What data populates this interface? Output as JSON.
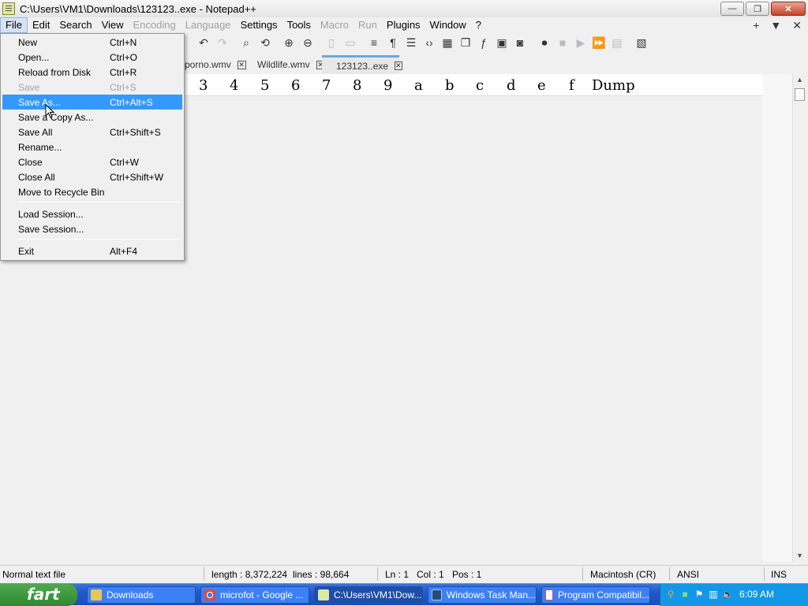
{
  "window": {
    "title": "C:\\Users\\VM1\\Downloads\\123123..exe - Notepad++",
    "controls": {
      "minimize": "—",
      "restore": "❐",
      "close": "✕"
    }
  },
  "menubar": {
    "items": [
      {
        "label": "File",
        "state": "open"
      },
      {
        "label": "Edit"
      },
      {
        "label": "Search"
      },
      {
        "label": "View"
      },
      {
        "label": "Encoding",
        "state": "disabled"
      },
      {
        "label": "Language",
        "state": "disabled"
      },
      {
        "label": "Settings"
      },
      {
        "label": "Tools"
      },
      {
        "label": "Macro",
        "state": "disabled"
      },
      {
        "label": "Run",
        "state": "disabled"
      },
      {
        "label": "Plugins"
      },
      {
        "label": "Window"
      },
      {
        "label": "?"
      }
    ],
    "right": {
      "add": "+",
      "dropdown": "▼",
      "close": "✕"
    }
  },
  "tabs": [
    {
      "label": "porno.wmv",
      "active": false
    },
    {
      "label": "Wildlife.wmv",
      "active": false
    },
    {
      "label": "123123..exe",
      "active": true
    }
  ],
  "hex_header": {
    "columns": [
      "3",
      "4",
      "5",
      "6",
      "7",
      "8",
      "9",
      "a",
      "b",
      "c",
      "d",
      "e",
      "f",
      "Dump"
    ]
  },
  "file_menu": {
    "items": [
      {
        "label": "New",
        "shortcut": "Ctrl+N"
      },
      {
        "label": "Open...",
        "shortcut": "Ctrl+O"
      },
      {
        "label": "Reload from Disk",
        "shortcut": "Ctrl+R"
      },
      {
        "label": "Save",
        "shortcut": "Ctrl+S",
        "disabled": true
      },
      {
        "label": "Save As...",
        "shortcut": "Ctrl+Alt+S",
        "highlighted": true
      },
      {
        "label": "Save a Copy As...",
        "shortcut": ""
      },
      {
        "label": "Save All",
        "shortcut": "Ctrl+Shift+S"
      },
      {
        "label": "Rename...",
        "shortcut": ""
      },
      {
        "label": "Close",
        "shortcut": "Ctrl+W"
      },
      {
        "label": "Close All",
        "shortcut": "Ctrl+Shift+W"
      },
      {
        "label": "Move to Recycle Bin",
        "shortcut": ""
      },
      {
        "label": "Load Session...",
        "shortcut": ""
      },
      {
        "label": "Save Session...",
        "shortcut": ""
      },
      {
        "label": "Exit",
        "shortcut": "Alt+F4"
      }
    ]
  },
  "statusbar": {
    "file_type": "Normal text file",
    "length": "length : 8,372,224",
    "lines": "lines : 98,664",
    "ln": "Ln : 1",
    "col": "Col : 1",
    "pos": "Pos : 1",
    "eol": "Macintosh (CR)",
    "encoding": "ANSI",
    "mode": "INS"
  },
  "taskbar": {
    "start_label": "fart",
    "tasks": [
      {
        "label": "Downloads",
        "icon": "folder-icon",
        "active": false
      },
      {
        "label": "microfot - Google ...",
        "icon": "chrome-icon",
        "active": false
      },
      {
        "label": "C:\\Users\\VM1\\Dow...",
        "icon": "notepadpp-icon",
        "active": true
      },
      {
        "label": "Windows Task Man...",
        "icon": "task-manager-icon",
        "active": false
      },
      {
        "label": "Program Compatibil...",
        "icon": "program-compat-icon",
        "active": false
      }
    ],
    "clock": "6:09 AM"
  },
  "colors": {
    "menu_highlight": "#3399ff",
    "taskbar": "#2357c8",
    "start_green": "#2f8a2f",
    "tray": "#1397e8"
  }
}
